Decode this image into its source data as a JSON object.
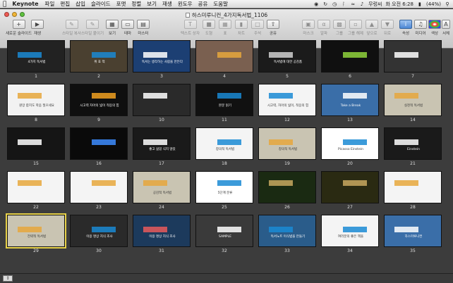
{
  "menubar": {
    "app": "Keynote",
    "items": [
      "파일",
      "편집",
      "삽입",
      "슬라이드",
      "포맷",
      "정렬",
      "보기",
      "재생",
      "윈도우",
      "공유",
      "도움말"
    ],
    "right": {
      "user": "무렁씨",
      "clock": "화 오전 6:28",
      "battery": "(44%)"
    }
  },
  "window": {
    "title": "하스미루니컨_4가지독서법_1106"
  },
  "toolbar": {
    "left": [
      {
        "label": "새로운 슬라이드",
        "icon": "plus-icon"
      },
      {
        "label": "재생",
        "icon": "play-icon"
      },
      {
        "label": "스타일 복사",
        "icon": "copy-style-icon"
      },
      {
        "label": "스타일 붙이기",
        "icon": "paste-style-icon"
      },
      {
        "label": "보기",
        "icon": "view-icon"
      },
      {
        "label": "테마",
        "icon": "theme-icon"
      },
      {
        "label": "마스터",
        "icon": "master-icon"
      }
    ],
    "center": [
      {
        "label": "텍스트 상자",
        "icon": "textbox-icon"
      },
      {
        "label": "도형",
        "icon": "shape-icon"
      },
      {
        "label": "표",
        "icon": "table-icon"
      },
      {
        "label": "차트",
        "icon": "chart-icon"
      },
      {
        "label": "주석",
        "icon": "comment-icon"
      },
      {
        "label": "공유",
        "icon": "share-icon"
      }
    ],
    "right": [
      {
        "label": "마스크",
        "icon": "mask-icon"
      },
      {
        "label": "알파",
        "icon": "alpha-icon"
      },
      {
        "label": "그룹",
        "icon": "group-icon"
      },
      {
        "label": "그룹 해제",
        "icon": "ungroup-icon"
      },
      {
        "label": "앞으로",
        "icon": "front-icon"
      },
      {
        "label": "뒤로",
        "icon": "back-icon"
      },
      {
        "label": "속성",
        "icon": "inspector-icon"
      },
      {
        "label": "미디어",
        "icon": "media-icon"
      },
      {
        "label": "색상",
        "icon": "colors-icon"
      },
      {
        "label": "서체",
        "icon": "fonts-icon"
      }
    ]
  },
  "slides": [
    {
      "n": "1",
      "bg": "#222222",
      "accent": "#1a8ad4",
      "text": "4가지 독서법"
    },
    {
      "n": "2",
      "bg": "#4a4030",
      "accent": "#1a8ad4",
      "text": "위 효 척"
    },
    {
      "n": "3",
      "bg": "#1c3f73",
      "accent": "#ffffff",
      "text": "독서는 생각하는 사람을 만든다"
    },
    {
      "n": "4",
      "bg": "#7a6050",
      "accent": "#e6a73c",
      "text": ""
    },
    {
      "n": "5",
      "bg": "#1b1b1b",
      "accent": "#cfcfcf",
      "text": "독서법에 대한 공감품"
    },
    {
      "n": "6",
      "bg": "#101010",
      "accent": "#8fd23c",
      "text": ""
    },
    {
      "n": "7",
      "bg": "#333333",
      "accent": "#ffffff",
      "text": ""
    },
    {
      "n": "8",
      "bg": "#f2f2f2",
      "accent": "#e6a73c",
      "text": "원망 합치도 학음 질으세요"
    },
    {
      "n": "9",
      "bg": "#0f0f0f",
      "accent": "#f0a020",
      "text": "시고력 자아의 넓이 적응의 힘"
    },
    {
      "n": "10",
      "bg": "#2a2a2a",
      "accent": "#ffffff",
      "text": ""
    },
    {
      "n": "11",
      "bg": "#111111",
      "accent": "#1a8ad4",
      "text": "본문 읽기"
    },
    {
      "n": "12",
      "bg": "#f4f4f4",
      "accent": "#1a8ad4",
      "text": "시고력, 자아의 넓이, 적응의 힘"
    },
    {
      "n": "13",
      "bg": "#3a6ea8",
      "accent": "#ffffff",
      "text": "Take a Break"
    },
    {
      "n": "14",
      "bg": "#c9c4b2",
      "accent": "#e6a73c",
      "text": "실천적 독서법"
    },
    {
      "n": "15",
      "bg": "#151515",
      "accent": "#ffffff",
      "text": ""
    },
    {
      "n": "16",
      "bg": "#0a0a0a",
      "accent": "#3d8cff",
      "text": ""
    },
    {
      "n": "17",
      "bg": "#1a1a1a",
      "accent": "#ffffff",
      "text": "좋고 싫었 식지 않았"
    },
    {
      "n": "18",
      "bg": "#f4f4f4",
      "accent": "#1a8ad4",
      "text": "창의적 독서법"
    },
    {
      "n": "19",
      "bg": "#c9c4b2",
      "accent": "#e6a73c",
      "text": "창의적 독서법"
    },
    {
      "n": "20",
      "bg": "#ffffff",
      "accent": "#1a8ad4",
      "text": "Picasso Einstein"
    },
    {
      "n": "21",
      "bg": "#1a1a1a",
      "accent": "#ffffff",
      "text": "Einstein"
    },
    {
      "n": "22",
      "bg": "#f4f4f4",
      "accent": "#e6a73c",
      "text": ""
    },
    {
      "n": "23",
      "bg": "#f4f4f4",
      "accent": "#e6a73c",
      "text": ""
    },
    {
      "n": "24",
      "bg": "#c9c4b2",
      "accent": "#e6a73c",
      "text": "공감적 독서법"
    },
    {
      "n": "25",
      "bg": "#ffffff",
      "accent": "#1a8ad4",
      "text": "5단계 분류"
    },
    {
      "n": "26",
      "bg": "#1a2a12",
      "accent": "#c8a860",
      "text": ""
    },
    {
      "n": "27",
      "bg": "#2a2a12",
      "accent": "#c8a860",
      "text": ""
    },
    {
      "n": "28",
      "bg": "#f4f4f4",
      "accent": "#e6a73c",
      "text": ""
    },
    {
      "n": "29",
      "bg": "#c9c4b2",
      "accent": "#e6a73c",
      "text": "전략적 독서법"
    },
    {
      "n": "30",
      "bg": "#2a2a2a",
      "accent": "#1a8ad4",
      "text": "이용 명상 지식 조사"
    },
    {
      "n": "31",
      "bg": "#1c3a5c",
      "accent": "#e85a5a",
      "text": "이용 명상 지식 조사"
    },
    {
      "n": "32",
      "bg": "#3a3a3a",
      "accent": "#ffffff",
      "text": "SAMPLE"
    },
    {
      "n": "33",
      "bg": "#2a5c8a",
      "accent": "#1a8ad4",
      "text": "독서노트 이식법을 만들기"
    },
    {
      "n": "34",
      "bg": "#f4f4f4",
      "accent": "#1a8ad4",
      "text": "여러분의 좋은 책을"
    },
    {
      "n": "35",
      "bg": "#3a6ea8",
      "accent": "#ffffff",
      "text": "하스미루니컨"
    }
  ]
}
